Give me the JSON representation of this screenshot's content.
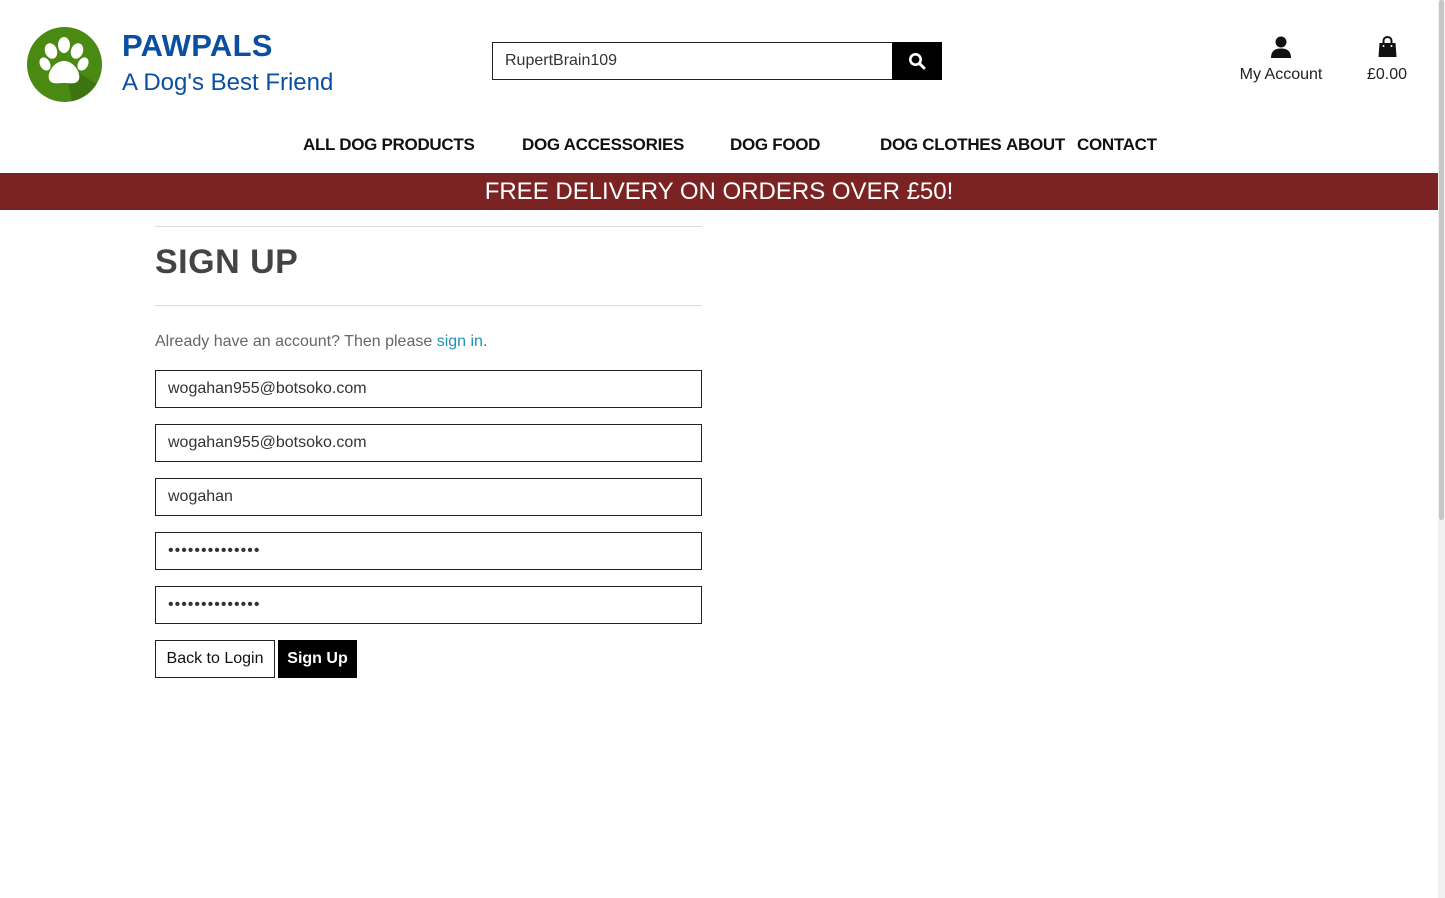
{
  "brand": {
    "name": "PAWPALS",
    "tagline": "A Dog's Best Friend",
    "logo_icon": "paw-icon",
    "logo_color": "#4a8a12",
    "name_color": "#0a4fa0"
  },
  "search": {
    "value": "RupertBrain109",
    "icon": "search-icon"
  },
  "account": {
    "label": "My Account",
    "icon": "user-icon"
  },
  "cart": {
    "total": "£0.00",
    "icon": "shopping-bag-icon"
  },
  "nav": {
    "all_products": "ALL DOG PRODUCTS",
    "accessories": "DOG ACCESSORIES",
    "food": "DOG FOOD",
    "clothes": "DOG CLOTHES",
    "about": "ABOUT",
    "contact": "CONTACT"
  },
  "banner": {
    "text": "FREE DELIVERY ON ORDERS OVER £50!",
    "color": "#7b2323"
  },
  "signup": {
    "title": "SIGN UP",
    "already_text": "Already have an account? Then please ",
    "signin_link": "sign in",
    "period": ".",
    "email": "wogahan955@botsoko.com",
    "email_confirm": "wogahan955@botsoko.com",
    "username": "wogahan",
    "password": "••••••••••••••",
    "password_confirm": "••••••••••••••",
    "back_button": "Back to Login",
    "submit_button": "Sign Up"
  }
}
